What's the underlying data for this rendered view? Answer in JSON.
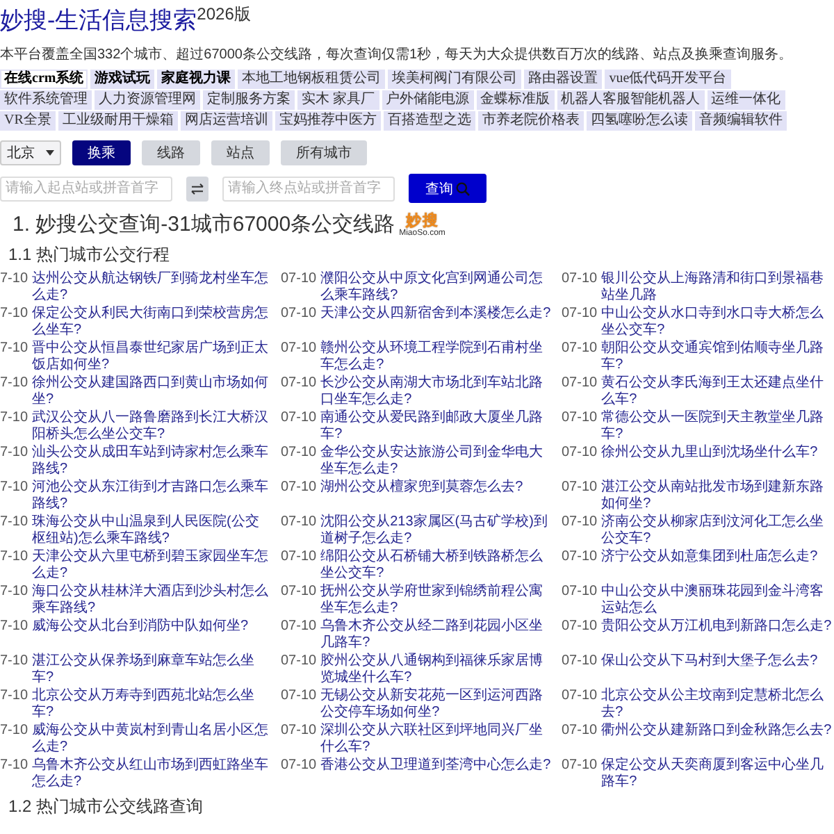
{
  "header": {
    "title": "妙搜-生活信息搜索$^{2026版}$",
    "description": "本平台覆盖全国332个城市、超过67000条公交线路，每次查询仅需1秒，每天为大众提供数百万次的线路、站点及换乘查询服务。"
  },
  "tag_rows": [
    {
      "tags": [
        {
          "label": "在线crm系统",
          "bold": true,
          "selected": true
        },
        {
          "label": "游戏试玩",
          "bold": true,
          "selected": false
        },
        {
          "label": "家庭视力课",
          "bold": true,
          "selected": false
        },
        {
          "label": "本地工地钢板租赁公司",
          "bold": false,
          "selected": false
        },
        {
          "label": "埃美柯阀门有限公司",
          "bold": false,
          "selected": false
        },
        {
          "label": "路由器设置",
          "bold": false,
          "selected": false
        },
        {
          "label": "vue低代码开发平台",
          "bold": false,
          "selected": false
        }
      ]
    },
    {
      "tags": [
        {
          "label": "软件系统管理",
          "bold": false,
          "selected": false
        },
        {
          "label": "人力资源管理网",
          "bold": false,
          "selected": false
        },
        {
          "label": "定制服务方案",
          "bold": false,
          "selected": false
        },
        {
          "label": "实木 家具厂",
          "bold": false,
          "selected": false
        },
        {
          "label": "户外储能电源",
          "bold": false,
          "selected": false
        },
        {
          "label": "金蝶标准版",
          "bold": false,
          "selected": false
        },
        {
          "label": "机器人客服智能机器人",
          "bold": false,
          "selected": false
        },
        {
          "label": "运维一体化",
          "bold": false,
          "selected": false
        }
      ]
    },
    {
      "tags": [
        {
          "label": "VR全景",
          "bold": false,
          "selected": false
        },
        {
          "label": "工业级耐用干燥箱",
          "bold": false,
          "selected": false
        },
        {
          "label": "网店运营培训",
          "bold": false,
          "selected": false
        },
        {
          "label": "宝妈推荐中医方",
          "bold": false,
          "selected": false
        },
        {
          "label": "百搭造型之选",
          "bold": false,
          "selected": false
        },
        {
          "label": "市养老院价格表",
          "bold": false,
          "selected": false
        },
        {
          "label": "四氢噻吩怎么读",
          "bold": false,
          "selected": false
        },
        {
          "label": "音频编辑软件",
          "bold": false,
          "selected": false
        }
      ]
    }
  ],
  "city_select": {
    "value": "北京"
  },
  "mode_buttons": [
    {
      "label": "换乘",
      "selected": true
    },
    {
      "label": "线路",
      "selected": false
    },
    {
      "label": "站点",
      "selected": false
    },
    {
      "label": "所有城市",
      "selected": false
    }
  ],
  "search": {
    "from_field": {
      "placeholder": "请输入起点站或拼音首字"
    },
    "to_field": {
      "placeholder": "请输入终点站或拼音首字"
    },
    "button": "查询"
  },
  "section": {
    "heading": "1. 妙搜公交查询-31城市67000条公交线路",
    "logo": {
      "text": "妙搜",
      "domain": "MiaoSo.com"
    }
  },
  "subsection": "1.1 热门城市公交行程",
  "trips": [
    {
      "date": "7-10",
      "title": "达州公交从航达钢铁厂到骑龙村坐车怎么走?"
    },
    {
      "date": "07-10",
      "title": "濮阳公交从中原文化宫到网通公司怎么乘车路线?"
    },
    {
      "date": "07-10",
      "title": "银川公交从上海路清和街口到景福巷站坐几路"
    },
    {
      "date": "7-10",
      "title": "保定公交从利民大街南口到荣校营房怎么坐车?"
    },
    {
      "date": "07-10",
      "title": "天津公交从四新宿舍到本溪楼怎么走?"
    },
    {
      "date": "07-10",
      "title": "中山公交从水口寺到水口寺大桥怎么坐公交车?"
    },
    {
      "date": "7-10",
      "title": "晋中公交从恒昌泰世纪家居广场到正太饭店如何坐?"
    },
    {
      "date": "07-10",
      "title": "赣州公交从环境工程学院到石甫村坐车怎么走?"
    },
    {
      "date": "07-10",
      "title": "朝阳公交从交通宾馆到佑顺寺坐几路车?"
    },
    {
      "date": "7-10",
      "title": "徐州公交从建国路西口到黄山市场如何坐?"
    },
    {
      "date": "07-10",
      "title": "长沙公交从南湖大市场北到车站北路口坐车怎么走?"
    },
    {
      "date": "07-10",
      "title": "黄石公交从李氏海到王太还建点坐什么车?"
    },
    {
      "date": "7-10",
      "title": "武汉公交从八一路鲁磨路到长江大桥汉阳桥头怎么坐公交车?"
    },
    {
      "date": "07-10",
      "title": "南通公交从爱民路到邮政大厦坐几路车?"
    },
    {
      "date": "07-10",
      "title": "常德公交从一医院到天主教堂坐几路车?"
    },
    {
      "date": "7-10",
      "title": "汕头公交从成田车站到诗家村怎么乘车路线?"
    },
    {
      "date": "07-10",
      "title": "金华公交从安达旅游公司到金华电大坐车怎么走?"
    },
    {
      "date": "07-10",
      "title": "徐州公交从九里山到沈场坐什么车?"
    },
    {
      "date": "7-10",
      "title": "河池公交从东江街到才吉路口怎么乘车路线?"
    },
    {
      "date": "07-10",
      "title": "湖州公交从檀家兜到莫蓉怎么去?"
    },
    {
      "date": "07-10",
      "title": "湛江公交从南站批发市场到建新东路如何坐?"
    },
    {
      "date": "7-10",
      "title": "珠海公交从中山温泉到人民医院(公交枢纽站)怎么乘车路线?"
    },
    {
      "date": "07-10",
      "title": "沈阳公交从213家属区(马古矿学校)到道树子怎么走?"
    },
    {
      "date": "07-10",
      "title": "济南公交从柳家店到汶河化工怎么坐公交车?"
    },
    {
      "date": "7-10",
      "title": "天津公交从六里屯桥到碧玉家园坐车怎么走?"
    },
    {
      "date": "07-10",
      "title": "绵阳公交从石桥铺大桥到铁路桥怎么坐公交车?"
    },
    {
      "date": "07-10",
      "title": "济宁公交从如意集团到杜庙怎么走?"
    },
    {
      "date": "7-10",
      "title": "海口公交从桂林洋大酒店到沙头村怎么乘车路线?"
    },
    {
      "date": "07-10",
      "title": "抚州公交从学府世家到锦绣前程公寓坐车怎么走?"
    },
    {
      "date": "07-10",
      "title": "中山公交从中澳丽珠花园到金斗湾客运站怎么"
    },
    {
      "date": "7-10",
      "title": "威海公交从北台到消防中队如何坐?"
    },
    {
      "date": "07-10",
      "title": "乌鲁木齐公交从经二路到花园小区坐几路车?"
    },
    {
      "date": "07-10",
      "title": "贵阳公交从万江机电到新路口怎么走?"
    },
    {
      "date": "7-10",
      "title": "湛江公交从保养场到麻章车站怎么坐车?"
    },
    {
      "date": "07-10",
      "title": "胶州公交从八通钢构到福徕乐家居博览城坐什么车?"
    },
    {
      "date": "07-10",
      "title": "保山公交从下马村到大堡子怎么去?"
    },
    {
      "date": "7-10",
      "title": "北京公交从万寿寺到西苑北站怎么坐车?"
    },
    {
      "date": "07-10",
      "title": "无锡公交从新安花苑一区到运河西路公交停车场如何坐?"
    },
    {
      "date": "07-10",
      "title": "北京公交从公主坟南到定慧桥北怎么去?"
    },
    {
      "date": "7-10",
      "title": "威海公交从中黄岚村到青山名居小区怎么走?"
    },
    {
      "date": "07-10",
      "title": "深圳公交从六联社区到坪地同兴厂坐什么车?"
    },
    {
      "date": "07-10",
      "title": "衢州公交从建新路口到金秋路怎么去?"
    },
    {
      "date": "7-10",
      "title": "乌鲁木齐公交从红山市场到西虹路坐车怎么走?"
    },
    {
      "date": "07-10",
      "title": "香港公交从卫理道到荃湾中心怎么走?"
    },
    {
      "date": "07-10",
      "title": "保定公交从天奕商厦到客运中心坐几路车?"
    }
  ],
  "next_subsection": "1.2 热门城市公交线路查询"
}
